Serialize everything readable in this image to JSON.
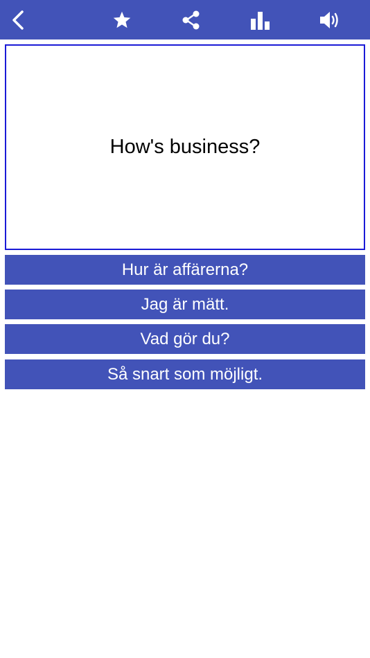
{
  "toolbar": {
    "icons": [
      "chevron-left-icon",
      "star-icon",
      "share-icon",
      "bar-chart-icon",
      "speaker-icon"
    ],
    "color": "#4253b8"
  },
  "question": {
    "text": "How's business?",
    "border_color": "#1a1ad6"
  },
  "answers": [
    {
      "label": "Hur är affärerna?"
    },
    {
      "label": "Jag är mätt."
    },
    {
      "label": "Vad gör du?"
    },
    {
      "label": "Så snart som möjligt."
    }
  ],
  "colors": {
    "accent": "#4253b8",
    "background": "#ffffff"
  }
}
